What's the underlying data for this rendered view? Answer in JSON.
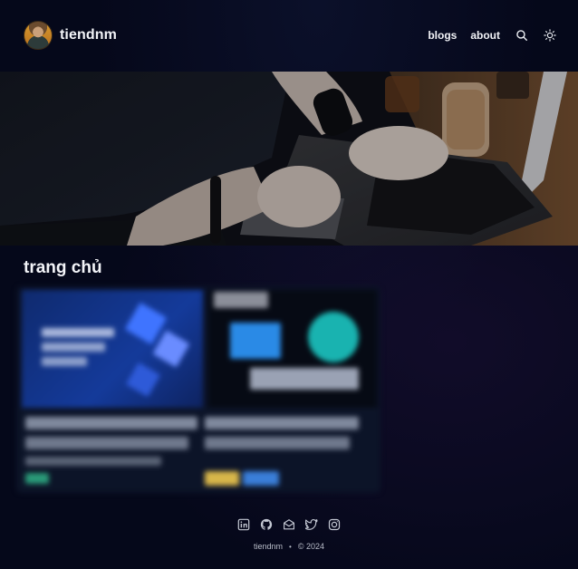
{
  "header": {
    "site_name": "tiendnm",
    "nav": {
      "blogs": "blogs",
      "about": "about"
    }
  },
  "icons": {
    "search": "search-icon",
    "theme": "sun-icon",
    "social": [
      "linkedin-icon",
      "github-icon",
      "mail-icon",
      "twitter-icon",
      "instagram-icon"
    ]
  },
  "main": {
    "title": "trang chủ"
  },
  "footer": {
    "owner": "tiendnm",
    "separator": "•",
    "copyright": "© 2024"
  },
  "colors": {
    "background": "#05081a",
    "text": "#f3f4f8",
    "muted": "#b9bdc9"
  }
}
